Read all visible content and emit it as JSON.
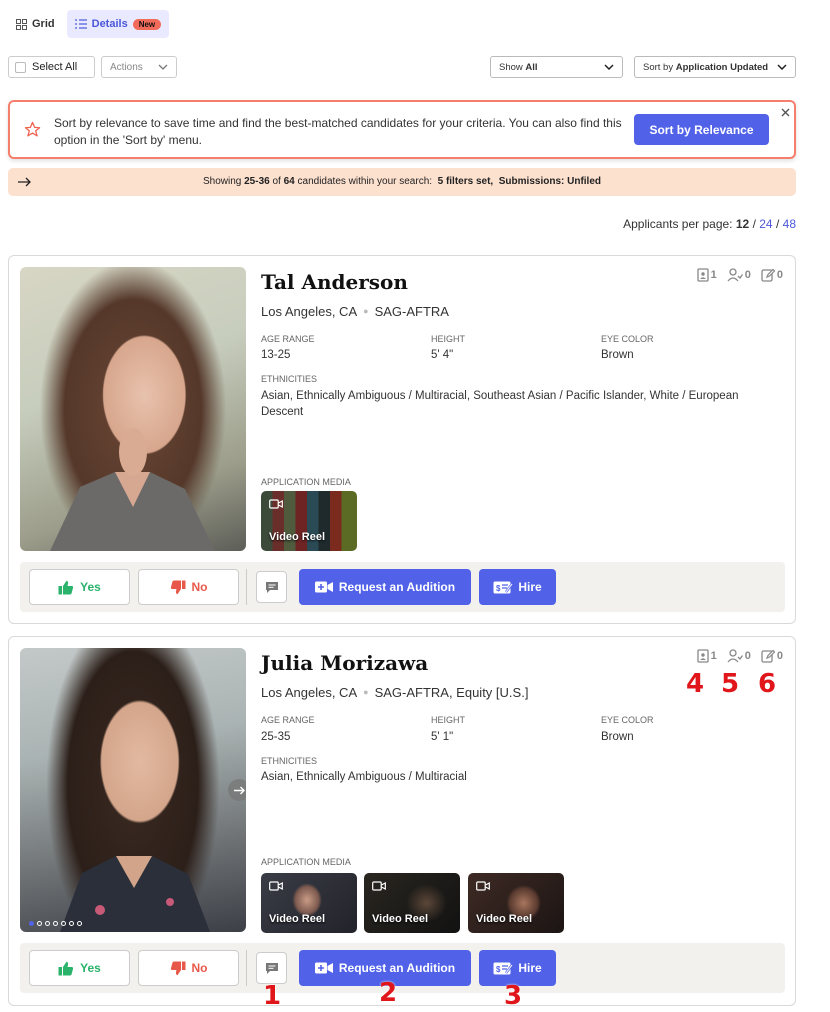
{
  "view_toggle": {
    "grid_label": "Grid",
    "details_label": "Details",
    "new_badge": "New"
  },
  "toolbar": {
    "select_all": "Select All",
    "actions": "Actions",
    "show_prefix": "Show",
    "show_value": "All",
    "sort_prefix": "Sort by",
    "sort_value": "Application Updated"
  },
  "banner": {
    "text": "Sort by relevance to save time and find the best-matched candidates for your criteria. You can also find this option in the 'Sort by' menu.",
    "button": "Sort by Relevance"
  },
  "showing": {
    "prefix": "Showing",
    "range": "25-36",
    "of": "of",
    "total": "64",
    "mid": "candidates within your search:",
    "filters": "5 filters set,",
    "submissions": "Submissions: Unfiled"
  },
  "per_page": {
    "label": "Applicants per page:",
    "current": "12",
    "opt2": "24",
    "opt3": "48",
    "sep": "/"
  },
  "labels": {
    "age_range": "AGE RANGE",
    "height": "HEIGHT",
    "eye_color": "EYE COLOR",
    "ethnicities": "ETHNICITIES",
    "application_media": "APPLICATION MEDIA",
    "yes": "Yes",
    "no": "No",
    "request_audition": "Request an Audition",
    "hire": "Hire",
    "video_reel": "Video Reel"
  },
  "candidates": [
    {
      "name": "Tal Anderson",
      "location": "Los Angeles, CA",
      "union": "SAG-AFTRA",
      "age_range": "13-25",
      "height": "5' 4\"",
      "eye_color": "Brown",
      "ethnicities": "Asian, Ethnically Ambiguous / Multiracial, Southeast Asian / Pacific Islander, White / European Descent",
      "stats": {
        "docs": "1",
        "reviews": "0",
        "notes": "0"
      }
    },
    {
      "name": "Julia Morizawa",
      "location": "Los Angeles, CA",
      "union": "SAG-AFTRA, Equity [U.S.]",
      "age_range": "25-35",
      "height": "5' 1\"",
      "eye_color": "Brown",
      "ethnicities": "Asian, Ethnically Ambiguous / Multiracial",
      "stats": {
        "docs": "1",
        "reviews": "0",
        "notes": "0"
      }
    }
  ],
  "annotations": [
    "1",
    "2",
    "3",
    "4",
    "5",
    "6"
  ],
  "colors": {
    "primary": "#5162e8",
    "banner_border": "#f47f6c",
    "showing_bg": "#fde1cf",
    "yes": "#2bb36b",
    "no": "#e8584a",
    "annotation": "#e0161a"
  }
}
